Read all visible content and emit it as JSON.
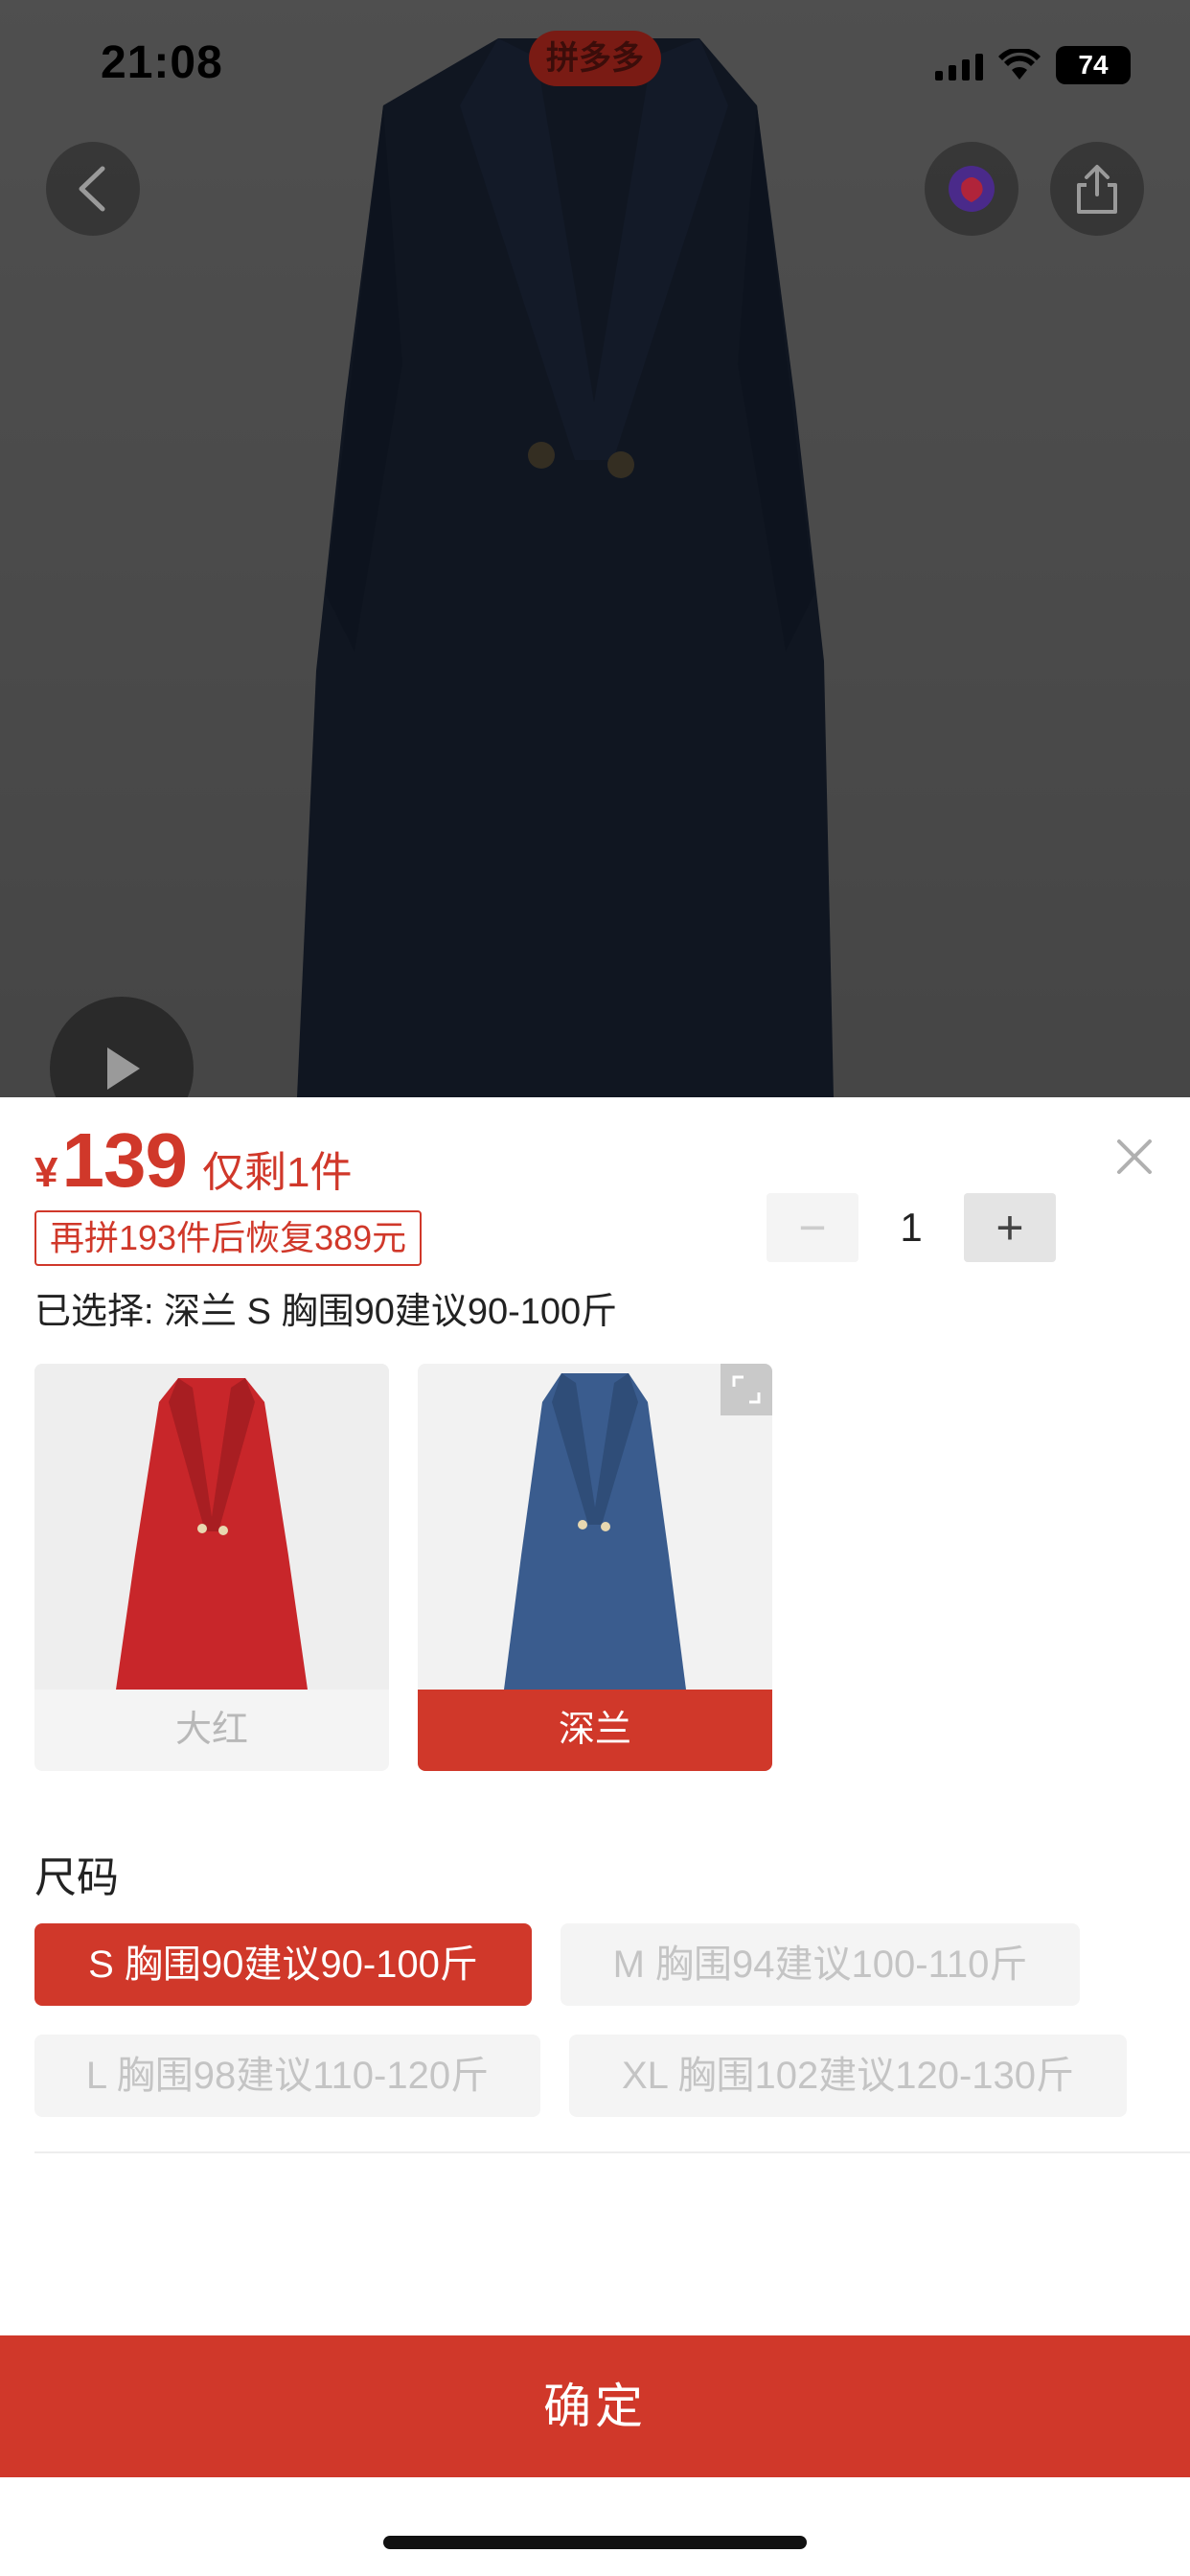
{
  "status_bar": {
    "time": "21:08",
    "app_badge": "拼多多",
    "battery": "74"
  },
  "product": {
    "price_symbol": "¥",
    "price": "139",
    "stock_note": "仅剩1件",
    "promo": "再拼193件后恢复389元",
    "selected_prefix": "已选择:",
    "selected_value": "深兰 S 胸围90建议90-100斤"
  },
  "quantity": {
    "value": "1",
    "minus": "−",
    "plus": "+"
  },
  "colors": [
    {
      "label": "大红",
      "color": "#c8262a",
      "active": false
    },
    {
      "label": "深兰",
      "color": "#3a5c8e",
      "active": true
    }
  ],
  "size": {
    "title": "尺码",
    "options": [
      {
        "label": "S 胸围90建议90-100斤",
        "active": true
      },
      {
        "label": "M 胸围94建议100-110斤",
        "active": false
      },
      {
        "label": "L 胸围98建议110-120斤",
        "active": false
      },
      {
        "label": "XL 胸围102建议120-130斤",
        "active": false
      }
    ]
  },
  "confirm_label": "确定",
  "icons": {
    "back": "chevron-left-icon",
    "favorite": "favorite-icon",
    "share": "share-icon",
    "play": "play-icon",
    "close": "close-icon",
    "expand": "expand-icon"
  }
}
